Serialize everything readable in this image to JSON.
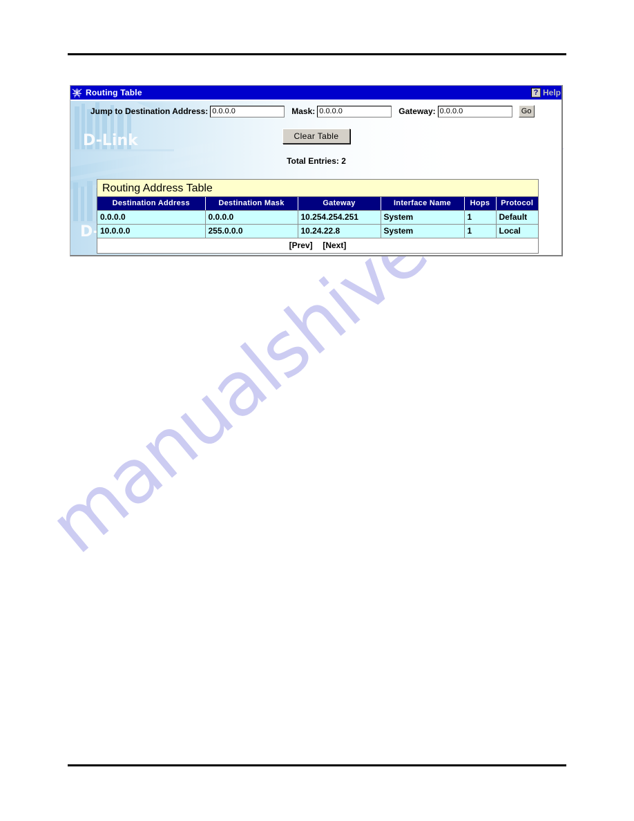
{
  "page": {
    "watermark_text": "manualshive.com"
  },
  "panel": {
    "titlebar": {
      "icon": "spiderweb-icon",
      "title": "Routing Table",
      "help_icon": "question-mark-icon",
      "help_label": "Help"
    },
    "form": {
      "dest_label": "Jump to Destination Address:",
      "dest_value": "0.0.0.0",
      "dest_placeholder": "0.0.0.0",
      "mask_label": "Mask:",
      "mask_value": "0.0.0.0",
      "mask_placeholder": "0.0.0.0",
      "gateway_label": "Gateway:",
      "gateway_value": "0.0.0.0",
      "gateway_placeholder": "0.0.0.0",
      "go_label": "Go"
    },
    "clear_button_label": "Clear Table",
    "total_entries_label": "Total Entries: 2",
    "table": {
      "caption": "Routing Address Table",
      "headers": [
        "Destination Address",
        "Destination Mask",
        "Gateway",
        "Interface Name",
        "Hops",
        "Protocol"
      ],
      "rows": [
        {
          "destination_address": "0.0.0.0",
          "destination_mask": "0.0.0.0",
          "gateway": "10.254.254.251",
          "interface_name": "System",
          "hops": "1",
          "protocol": "Default"
        },
        {
          "destination_address": "10.0.0.0",
          "destination_mask": "255.0.0.0",
          "gateway": "10.24.22.8",
          "interface_name": "System",
          "hops": "1",
          "protocol": "Local"
        }
      ],
      "pager": {
        "prev": "[Prev]",
        "next": "[Next]"
      }
    }
  },
  "colors": {
    "titlebar_blue": "#0000cc",
    "header_navy": "#000080",
    "row_cyan": "#ccffff",
    "caption_cream": "#ffffcc",
    "button_face": "#d4d0c8",
    "watermark_lavender": "#ccccf2"
  }
}
